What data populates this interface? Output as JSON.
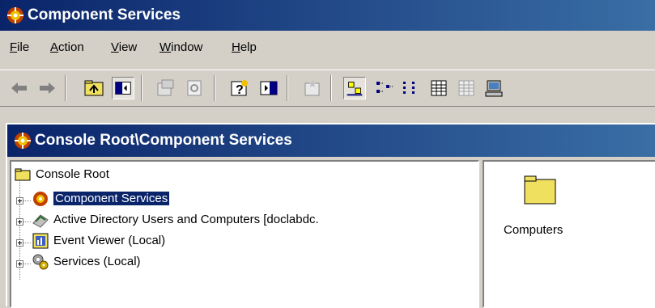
{
  "app": {
    "title": "Component Services"
  },
  "menu": [
    "File",
    "Action",
    "View",
    "Window",
    "Help"
  ],
  "menu_mnemonics": [
    "F",
    "A",
    "V",
    "W",
    "H"
  ],
  "toolbar": {
    "icons": [
      "back-icon",
      "forward-icon",
      "up-folder-icon",
      "show-hide-tree-icon",
      "properties-icon",
      "refresh-icon",
      "help-icon",
      "action-pane-icon",
      "new-window-icon",
      "large-icons-view-icon",
      "small-icons-view-icon",
      "list-view-icon",
      "detail-view-icon",
      "disabled-detail-icon",
      "computer-icon"
    ]
  },
  "child_window": {
    "title": "Console Root\\Component Services"
  },
  "tree": {
    "root": "Console Root",
    "items": [
      {
        "label": "Component Services",
        "icon": "component-services-icon",
        "selected": true
      },
      {
        "label": "Active Directory Users and Computers [doclabdc.",
        "icon": "ad-users-icon",
        "selected": false
      },
      {
        "label": "Event Viewer (Local)",
        "icon": "event-viewer-icon",
        "selected": false
      },
      {
        "label": "Services (Local)",
        "icon": "services-icon",
        "selected": false
      }
    ]
  },
  "content": {
    "items": [
      {
        "label": "Computers",
        "icon": "folder-icon"
      }
    ]
  },
  "colors": {
    "titlebar_dark": "#0a246a",
    "titlebar_light": "#3a6ea5",
    "chrome": "#d4d0c8",
    "selection": "#0a246a"
  }
}
